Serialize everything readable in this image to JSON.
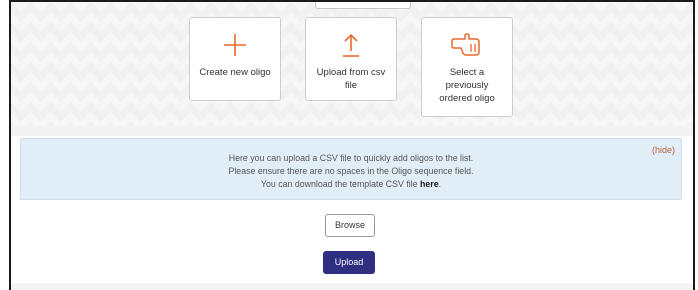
{
  "options": [
    {
      "label": "Create new oligo",
      "icon": "plus-icon"
    },
    {
      "label": "Upload from csv file",
      "icon": "upload-icon"
    },
    {
      "label": "Select a previously ordered oligo",
      "icon": "pointing-hand-icon"
    }
  ],
  "info": {
    "line1": "Here you can upload a CSV file to quickly add oligos to the list.",
    "line2": "Please ensure there are no spaces in the Oligo sequence field.",
    "line3_prefix": "You can download the template CSV file ",
    "line3_link": "here",
    "line3_suffix": ".",
    "hide_label": "(hide)"
  },
  "actions": {
    "browse_label": "Browse",
    "upload_label": "Upload"
  },
  "colors": {
    "accent_orange": "#E8692E",
    "upload_button": "#2F2F82",
    "info_background": "#E2EEF7",
    "hide_link": "#B5623B"
  }
}
